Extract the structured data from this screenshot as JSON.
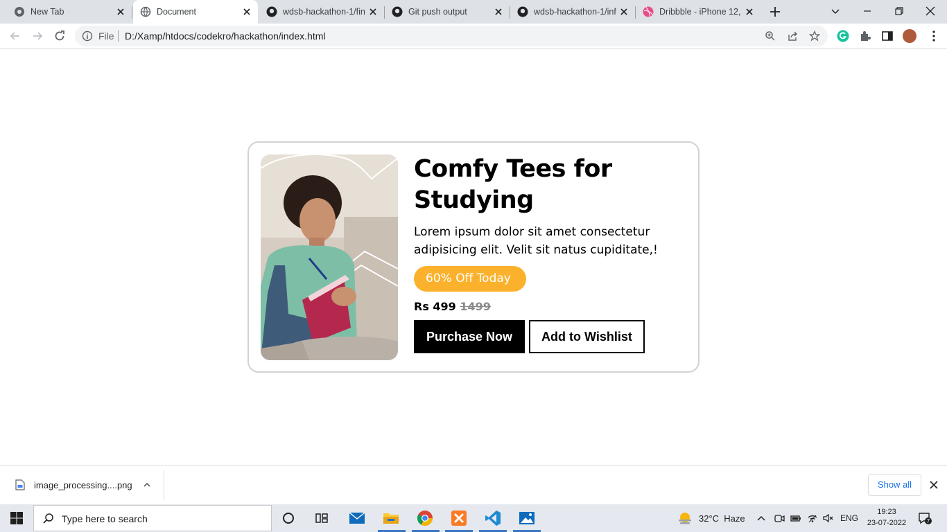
{
  "browser": {
    "tabs": [
      {
        "title": "New Tab",
        "icon": "chrome-icon",
        "active": false
      },
      {
        "title": "Document",
        "icon": "globe-icon",
        "active": true
      },
      {
        "title": "wdsb-hackathon-1/fin",
        "icon": "github-icon",
        "active": false
      },
      {
        "title": "Git push output",
        "icon": "github-icon",
        "active": false
      },
      {
        "title": "wdsb-hackathon-1/inf",
        "icon": "github-icon",
        "active": false
      },
      {
        "title": "Dribbble - iPhone 12,",
        "icon": "dribbble-icon",
        "active": false
      }
    ],
    "address": {
      "scheme_label": "File",
      "url": "D:/Xamp/htdocs/codekro/hackathon/index.html"
    }
  },
  "card": {
    "title": "Comfy Tees for Studying",
    "description": "Lorem ipsum dolor sit amet consectetur adipisicing elit. Velit sit natus cupiditate,!",
    "badge": "60% Off Today",
    "price": "Rs 499",
    "old_price": "1499",
    "purchase_label": "Purchase Now",
    "wishlist_label": "Add to Wishlist"
  },
  "downloads": {
    "file_name": "image_processing....png",
    "show_all": "Show all"
  },
  "taskbar": {
    "search_placeholder": "Type here to search",
    "temperature": "32°C",
    "weather": "Haze",
    "language": "ENG",
    "time": "19:23",
    "date": "23-07-2022",
    "notification_count": "7"
  },
  "colors": {
    "badge": "#fbb12b",
    "primary_button": "#000000",
    "tabstrip": "#dee1e6",
    "link": "#1a73e8"
  }
}
